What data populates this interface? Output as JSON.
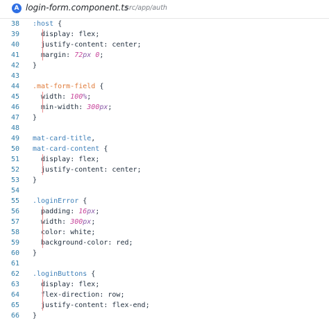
{
  "tab": {
    "icon": "angular-icon",
    "icon_letter": "A",
    "file_name": "login-form.component.ts",
    "file_path": "src/app/auth"
  },
  "lines": [
    {
      "n": "38",
      "tokens": [
        {
          "t": ":host",
          "c": "sel"
        },
        {
          "t": " {",
          "c": "punc"
        }
      ]
    },
    {
      "n": "39",
      "tokens": [
        {
          "t": "  display",
          "c": "prop"
        },
        {
          "t": ": ",
          "c": "punc"
        },
        {
          "t": "flex",
          "c": "kw"
        },
        {
          "t": ";",
          "c": "punc"
        }
      ]
    },
    {
      "n": "40",
      "tokens": [
        {
          "t": "  justify-content",
          "c": "prop"
        },
        {
          "t": ": ",
          "c": "punc"
        },
        {
          "t": "center",
          "c": "kw"
        },
        {
          "t": ";",
          "c": "punc"
        }
      ]
    },
    {
      "n": "41",
      "tokens": [
        {
          "t": "  margin",
          "c": "prop"
        },
        {
          "t": ": ",
          "c": "punc"
        },
        {
          "t": "72",
          "c": "num"
        },
        {
          "t": "px",
          "c": "unit"
        },
        {
          "t": " ",
          "c": "punc"
        },
        {
          "t": "0",
          "c": "num"
        },
        {
          "t": ";",
          "c": "punc"
        }
      ]
    },
    {
      "n": "42",
      "tokens": [
        {
          "t": "}",
          "c": "punc"
        }
      ]
    },
    {
      "n": "43",
      "tokens": []
    },
    {
      "n": "44",
      "tokens": [
        {
          "t": ".mat-form-field",
          "c": "sel-o"
        },
        {
          "t": " {",
          "c": "punc"
        }
      ]
    },
    {
      "n": "45",
      "tokens": [
        {
          "t": "  width",
          "c": "prop"
        },
        {
          "t": ": ",
          "c": "punc"
        },
        {
          "t": "100",
          "c": "num"
        },
        {
          "t": "%",
          "c": "unit"
        },
        {
          "t": ";",
          "c": "punc"
        }
      ]
    },
    {
      "n": "46",
      "tokens": [
        {
          "t": "  min-width",
          "c": "prop"
        },
        {
          "t": ": ",
          "c": "punc"
        },
        {
          "t": "300",
          "c": "num"
        },
        {
          "t": "px",
          "c": "unit"
        },
        {
          "t": ";",
          "c": "punc"
        }
      ]
    },
    {
      "n": "47",
      "tokens": [
        {
          "t": "}",
          "c": "punc"
        }
      ]
    },
    {
      "n": "48",
      "tokens": []
    },
    {
      "n": "49",
      "tokens": [
        {
          "t": "mat-card-title",
          "c": "sel"
        },
        {
          "t": ",",
          "c": "punc"
        }
      ]
    },
    {
      "n": "50",
      "tokens": [
        {
          "t": "mat-card-content",
          "c": "sel"
        },
        {
          "t": " {",
          "c": "punc"
        }
      ]
    },
    {
      "n": "51",
      "tokens": [
        {
          "t": "  display",
          "c": "prop"
        },
        {
          "t": ": ",
          "c": "punc"
        },
        {
          "t": "flex",
          "c": "kw"
        },
        {
          "t": ";",
          "c": "punc"
        }
      ]
    },
    {
      "n": "52",
      "tokens": [
        {
          "t": "  justify-content",
          "c": "prop"
        },
        {
          "t": ": ",
          "c": "punc"
        },
        {
          "t": "center",
          "c": "kw"
        },
        {
          "t": ";",
          "c": "punc"
        }
      ]
    },
    {
      "n": "53",
      "tokens": [
        {
          "t": "}",
          "c": "punc"
        }
      ]
    },
    {
      "n": "54",
      "tokens": []
    },
    {
      "n": "55",
      "tokens": [
        {
          "t": ".loginError",
          "c": "sel"
        },
        {
          "t": " {",
          "c": "punc"
        }
      ]
    },
    {
      "n": "56",
      "tokens": [
        {
          "t": "  padding",
          "c": "prop"
        },
        {
          "t": ": ",
          "c": "punc"
        },
        {
          "t": "16",
          "c": "num"
        },
        {
          "t": "px",
          "c": "unit"
        },
        {
          "t": ";",
          "c": "punc"
        }
      ]
    },
    {
      "n": "57",
      "tokens": [
        {
          "t": "  width",
          "c": "prop"
        },
        {
          "t": ": ",
          "c": "punc"
        },
        {
          "t": "300",
          "c": "num"
        },
        {
          "t": "px",
          "c": "unit"
        },
        {
          "t": ";",
          "c": "punc"
        }
      ]
    },
    {
      "n": "58",
      "tokens": [
        {
          "t": "  color",
          "c": "prop"
        },
        {
          "t": ": ",
          "c": "punc"
        },
        {
          "t": "white",
          "c": "kw"
        },
        {
          "t": ";",
          "c": "punc"
        }
      ]
    },
    {
      "n": "59",
      "tokens": [
        {
          "t": "  background-color",
          "c": "prop"
        },
        {
          "t": ": ",
          "c": "punc"
        },
        {
          "t": "red",
          "c": "kw"
        },
        {
          "t": ";",
          "c": "punc"
        }
      ]
    },
    {
      "n": "60",
      "tokens": [
        {
          "t": "}",
          "c": "punc"
        }
      ]
    },
    {
      "n": "61",
      "tokens": []
    },
    {
      "n": "62",
      "tokens": [
        {
          "t": ".loginButtons",
          "c": "sel"
        },
        {
          "t": " {",
          "c": "punc"
        }
      ]
    },
    {
      "n": "63",
      "tokens": [
        {
          "t": "  display",
          "c": "prop"
        },
        {
          "t": ": ",
          "c": "punc"
        },
        {
          "t": "flex",
          "c": "kw"
        },
        {
          "t": ";",
          "c": "punc"
        }
      ]
    },
    {
      "n": "64",
      "tokens": [
        {
          "t": "  flex-direction",
          "c": "prop"
        },
        {
          "t": ": ",
          "c": "punc"
        },
        {
          "t": "row",
          "c": "kw"
        },
        {
          "t": ";",
          "c": "punc"
        }
      ]
    },
    {
      "n": "65",
      "tokens": [
        {
          "t": "  justify-content",
          "c": "prop"
        },
        {
          "t": ": ",
          "c": "punc"
        },
        {
          "t": "flex-end",
          "c": "kw"
        },
        {
          "t": ";",
          "c": "punc"
        }
      ]
    },
    {
      "n": "66",
      "tokens": [
        {
          "t": "}",
          "c": "punc"
        }
      ]
    }
  ]
}
